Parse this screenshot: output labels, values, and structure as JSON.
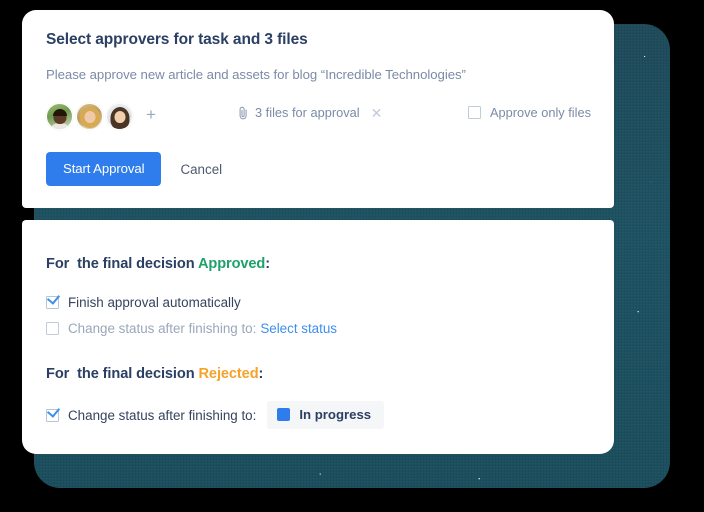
{
  "dialog": {
    "title": "Select approvers for task and 3 files",
    "subtitle": "Please approve new article and assets for blog “Incredible Technologies”",
    "approvers": {
      "add_label": "+",
      "avatars": [
        "avatar-person-1",
        "avatar-person-2",
        "avatar-person-3"
      ]
    },
    "files_chip": {
      "icon": "paperclip-icon",
      "label": "3 files for approval",
      "remove_label": "✕"
    },
    "approve_only_files": {
      "label": "Approve only files",
      "checked": false
    },
    "actions": {
      "primary_label": "Start Approval",
      "cancel_label": "Cancel"
    }
  },
  "settings": {
    "approved_section": {
      "prefix": "For  the final decision ",
      "decision": "Approved",
      "suffix": ":",
      "options": [
        {
          "label": "Finish approval automatically",
          "checked": true
        },
        {
          "label": "Change status after finishing to:",
          "link": "Select status",
          "checked": false
        }
      ]
    },
    "rejected_section": {
      "prefix": "For  the final decision ",
      "decision": "Rejected",
      "suffix": ":",
      "options": [
        {
          "label": "Change status after finishing to:",
          "checked": true
        }
      ],
      "status_pill": {
        "swatch": "status-color-swatch",
        "name": "In progress"
      }
    }
  },
  "colors": {
    "primary_blue": "#2f7ced",
    "link_blue": "#3e8ef0",
    "approved_green": "#20a06a",
    "rejected_orange": "#f5a32a",
    "title_navy": "#2a3f63",
    "muted": "#7b8ba6",
    "frame_teal": "#1c5565"
  }
}
